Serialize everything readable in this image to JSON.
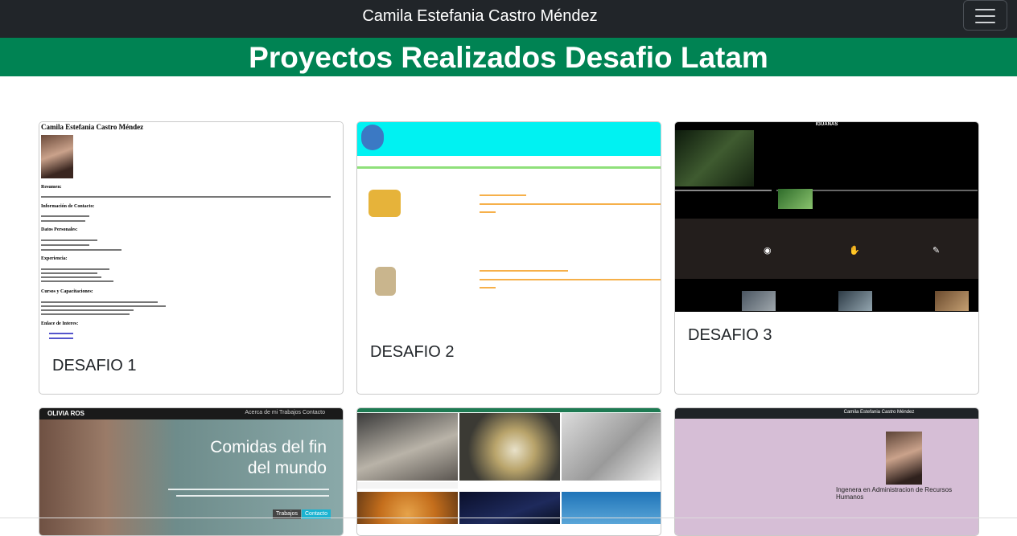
{
  "navbar": {
    "brand": "Camila Estefania Castro Méndez",
    "toggle_icon": "hamburger-icon"
  },
  "hero": {
    "title": "Proyectos Realizados Desafio Latam",
    "background": "#008353"
  },
  "cards": [
    {
      "title": "DESAFIO 1",
      "preview": {
        "name": "Camila Estefania Castro Méndez",
        "sections": [
          "Resumen:",
          "Información de Contacto:",
          "Datos Personales:",
          "Experiencia:",
          "Cursos y Capacitaciones:",
          "Enlace de Interes:"
        ]
      }
    },
    {
      "title": "DESAFIO 2"
    },
    {
      "title": "DESAFIO 3",
      "preview": {
        "heading": "IGUANAS"
      }
    },
    {
      "title": "",
      "preview": {
        "brand": "OLIVIA ROS",
        "links": "Acerca de mi   Trabajos   Contacto",
        "heading_line1": "Comidas del fin",
        "heading_line2": "del mundo",
        "button1": "Trabajos",
        "button2": "Contacto"
      }
    },
    {
      "title": ""
    },
    {
      "title": "",
      "preview": {
        "nav_text": "Camila Estefania Castro Méndez",
        "caption": "Ingenera en Administracion de Recursos Humanos"
      }
    }
  ]
}
